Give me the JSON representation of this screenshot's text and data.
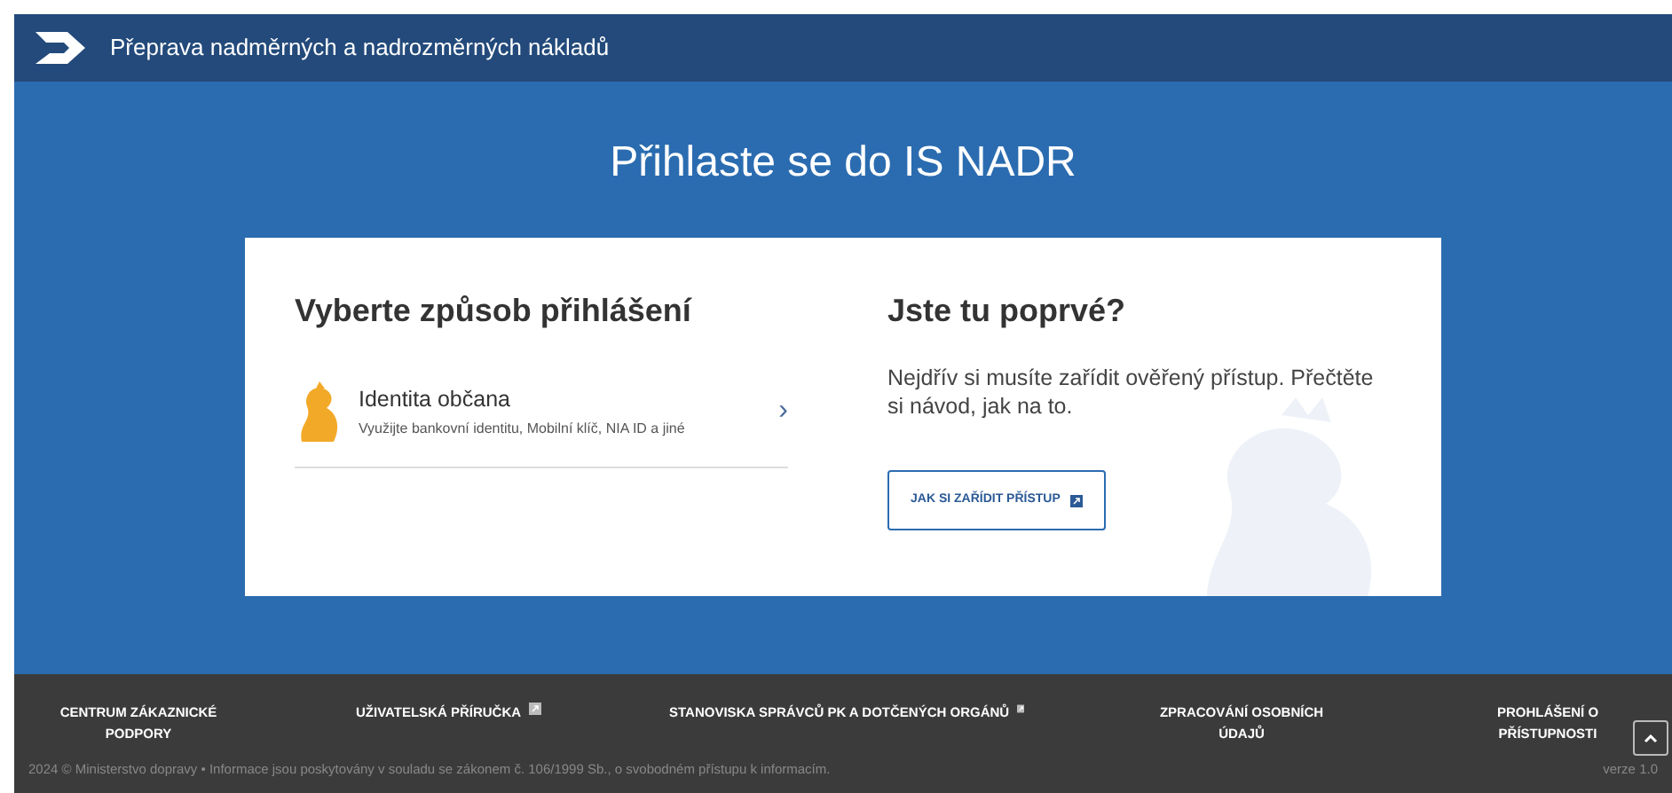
{
  "header": {
    "title": "Přeprava nadměrných a nadrozměrných nákladů"
  },
  "page_title": "Přihlaste se do IS NADR",
  "login": {
    "heading": "Vyberte způsob přihlášení",
    "methods": [
      {
        "name": "Identita občana",
        "description": "Využijte bankovní identitu, Mobilní klíč, NIA ID a jiné",
        "chevron": "›"
      }
    ]
  },
  "first_time": {
    "heading": "Jste tu poprvé?",
    "text": "Nejdřív si musíte zařídit ověřený přístup. Přečtěte si návod, jak na to.",
    "button": {
      "label": "JAK SI ZAŘÍDIT PŘÍSTUP",
      "external": true
    }
  },
  "footer": {
    "links": [
      {
        "label": "CENTRUM ZÁKAZNICKÉ PODPORY",
        "external": false
      },
      {
        "label": "UŽIVATELSKÁ PŘÍRUČKA",
        "external": true
      },
      {
        "label": "STANOVISKA SPRÁVCŮ PK A DOTČENÝCH ORGÁNŮ",
        "external": true
      },
      {
        "label": "ZPRACOVÁNÍ OSOBNÍCH ÚDAJŮ",
        "external": false
      },
      {
        "label": "PROHLÁŠENÍ O PŘÍSTUPNOSTI",
        "external": false
      }
    ],
    "copyright": "2024 © Ministerstvo dopravy • Informace jsou poskytovány v souladu se zákonem č. 106/1999 Sb., o svobodném přístupu k informacím.",
    "version": "verze 1.0"
  }
}
